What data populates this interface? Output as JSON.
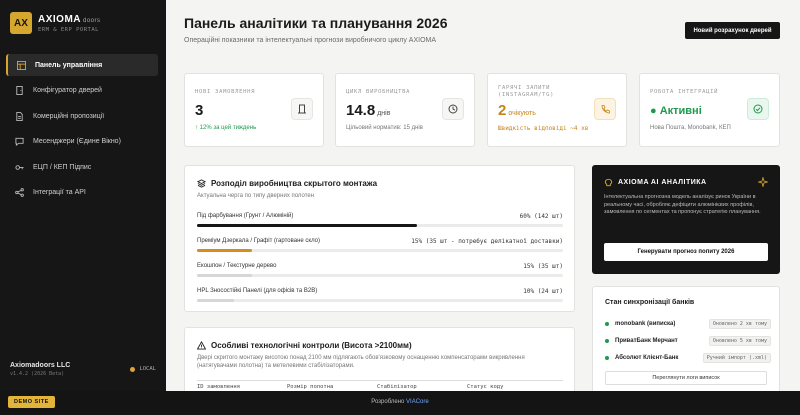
{
  "brand": {
    "logo": "AX",
    "name": "AXIOMA",
    "name_sub": "doors",
    "tagline": "ERM & ERP PORTAL"
  },
  "sidebar": {
    "items": [
      {
        "label": "Панель управління",
        "icon": "grid-icon",
        "active": true
      },
      {
        "label": "Конфігуратор дверей",
        "icon": "door-icon"
      },
      {
        "label": "Комерційні пропозиції",
        "icon": "document-icon"
      },
      {
        "label": "Месенджери (Єдине Вікно)",
        "icon": "chat-icon"
      },
      {
        "label": "ЕЦП / КЕП Підпис",
        "icon": "key-icon"
      },
      {
        "label": "Інтеграції та API",
        "icon": "share-icon"
      }
    ],
    "footer": {
      "company": "Axiomadoors LLC",
      "version": "v1.4.2 (2026 Beta)",
      "status": "LOCAL"
    }
  },
  "bottombar": {
    "demo": "DEMO SITE",
    "powered_prefix": "Розроблено",
    "powered_link": "VIACore"
  },
  "header": {
    "title": "Панель аналітики та планування 2026",
    "subtitle": "Операційні показники та інтелектуальні прогнози виробничого циклу AXIOMA",
    "new_button": "Новий розрахунок дверей"
  },
  "kpis": [
    {
      "label": "Нові замовлення",
      "value": "3",
      "unit": "",
      "foot": "↑ 12% за цей тиждень",
      "icon": "door-icon"
    },
    {
      "label": "Цикл виробництва",
      "value": "14.8",
      "unit": "днів",
      "foot": "Цільовий норматив: 15 днів",
      "icon": "clock-icon"
    },
    {
      "label": "Гарячі запити (Instagram/TG)",
      "value": "2",
      "unit": "очікують",
      "foot": "Швидкість відповіді ~4 хв",
      "icon": "phone-icon"
    },
    {
      "label": "Робота інтеграцій",
      "value": "● Активні",
      "unit": "",
      "foot": "Нова Пошта, Monobank, КЕП",
      "icon": "check-circle-icon"
    }
  ],
  "production": {
    "title": "Розподіл виробництва скрытого монтажа",
    "subtitle": "Актуальна черга по типу дверних полотен",
    "rows": [
      {
        "label": "Під фарбування (Грунт / Алюміній)",
        "value": "60% (142 шт)",
        "percent": 60,
        "color": "#161616"
      },
      {
        "label": "Преміум Дзеркала / Графіт (гартоване скло)",
        "value": "15% (35 шт - потребує делікатної доставки)",
        "percent": 15,
        "color": "#d98b1e"
      },
      {
        "label": "Екошпон / Текстурне дерево",
        "value": "15% (35 шт)",
        "percent": 15,
        "color": "#d6d6d4"
      },
      {
        "label": "HPL Зносостійкі Панелі (для офісів та B2B)",
        "value": "10% (24 шт)",
        "percent": 10,
        "color": "#d6d6d4"
      }
    ]
  },
  "tech": {
    "title": "Особливі технологічні контроли (Висота >2100мм)",
    "text": "Двері скритого монтажу висотою понад 2100 мм підлягають обов'язковому оснащенню компенсаторами викривлення (натягувачами полотна) та метелевими стабілізаторами.",
    "columns": [
      "ID замовлення",
      "Розмір полотна",
      "Стабілізатор",
      "Статус коду"
    ]
  },
  "ai": {
    "title": "AXIOMA AI АНАЛІТИКА",
    "text": "Інтелектуальна прогнозна модель аналізує ринок України в реальному часі, обробляє дефіцити алюмінієвих профілів, замовлення по сегментах та пропонує стратегію планування.",
    "button": "Генерувати прогноз попиту 2026"
  },
  "banks": {
    "title": "Стан синхронізації банків",
    "rows": [
      {
        "name": "monobank (виписка)",
        "badge": "Оновлено 2 хв тому"
      },
      {
        "name": "ПриватБанк Мерчант",
        "badge": "Оновлено 5 хв тому"
      },
      {
        "name": "Абсолют Клієнт-Банк",
        "badge": "Ручний імпорт (.xml)"
      }
    ],
    "button": "Переглянути логи виписок"
  },
  "colors": {
    "accent": "#d6a72e",
    "dark": "#161616",
    "green": "#1e9a4d",
    "orange": "#c7841a"
  }
}
